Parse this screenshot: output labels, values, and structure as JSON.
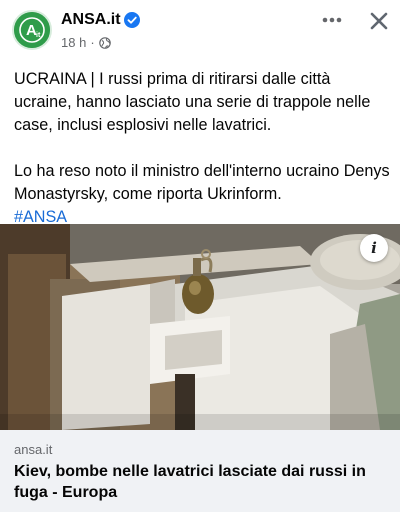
{
  "header": {
    "page_name": "ANSA.it",
    "time": "18 h",
    "separator": "·",
    "avatar_label": "A",
    "avatar_sublabel": "it"
  },
  "icons": {
    "verified": "verified-badge-icon",
    "audience": "globe-icon",
    "more": "more-options-icon",
    "close": "close-icon",
    "info": "info-icon"
  },
  "post": {
    "paragraph_1": "UCRAINA | I russi prima di ritirarsi dalle città ucraine, hanno lasciato una serie di trappole nelle case, inclusi esplosivi nelle lavatrici.",
    "paragraph_2": "Lo ha reso noto il ministro dell'interno ucraino Denys Monastyrsky, come riporta Ukrinform.",
    "hashtag": "#ANSA"
  },
  "media": {
    "info_label": "i"
  },
  "link_card": {
    "domain": "ansa.it",
    "title": "Kiev, bombe nelle lavatrici lasciate dai russi in fuga - Europa"
  },
  "colors": {
    "brand_green": "#2f9c4a",
    "verified_blue": "#1877f2",
    "hashtag_blue": "#1a6cd6",
    "card_background": "#f0f2f5"
  }
}
